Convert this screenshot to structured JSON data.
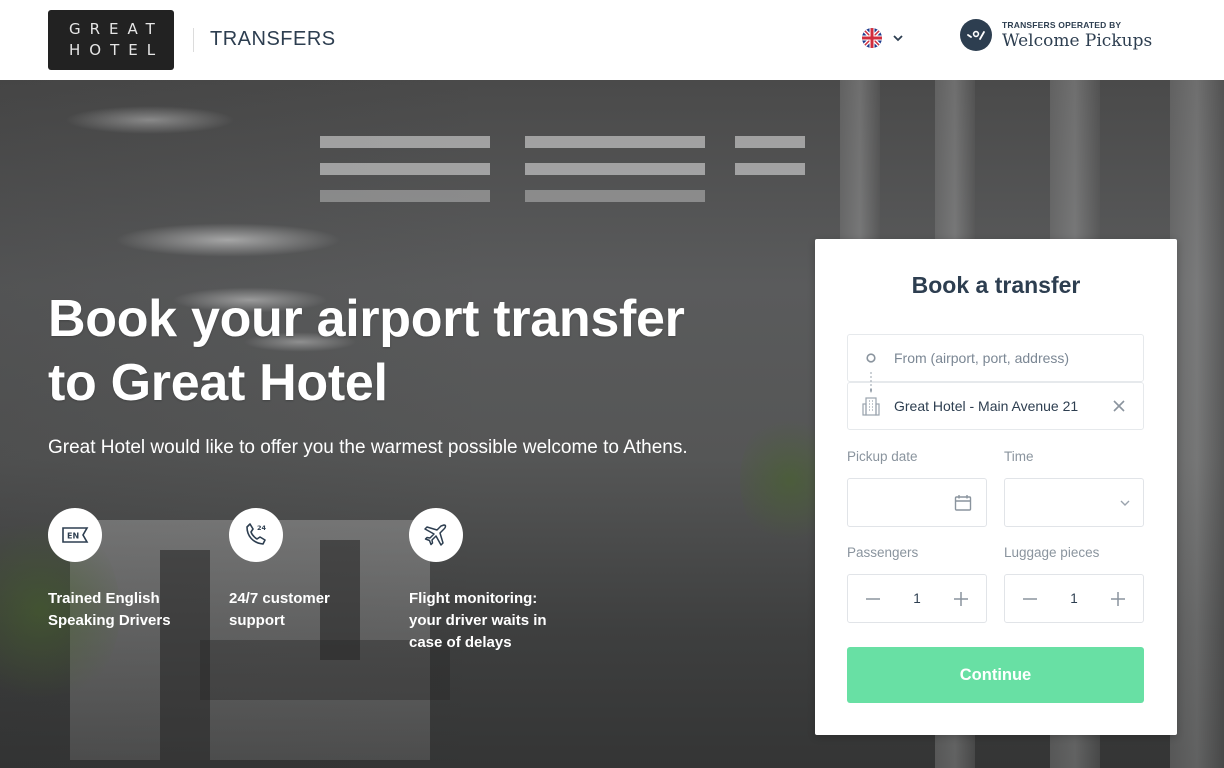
{
  "header": {
    "logo_line1": "GREAT",
    "logo_line2": "HOTEL",
    "section_title": "TRANSFERS",
    "language": {
      "icon": "uk-flag-icon",
      "selected": "English"
    },
    "operator_caption": "TRANSFERS OPERATED BY",
    "operator_name": "Welcome Pickups"
  },
  "hero": {
    "title_line1": "Book your airport transfer",
    "title_line2": "to Great Hotel",
    "subtitle": "Great Hotel would like to offer you the warmest possible welcome to Athens.",
    "features": [
      {
        "icon": "english-speaking-icon",
        "icon_text": "EN",
        "line1": "Trained English",
        "line2": "Speaking Drivers",
        "line3": ""
      },
      {
        "icon": "phone-24-icon",
        "icon_text": "24",
        "line1": "24/7 customer",
        "line2": "support",
        "line3": ""
      },
      {
        "icon": "airplane-icon",
        "icon_text": "",
        "line1": "Flight monitoring:",
        "line2": "your driver waits in",
        "line3": "case of delays"
      }
    ]
  },
  "booking": {
    "title": "Book a transfer",
    "from_placeholder": "From (airport, port, address)",
    "from_value": "",
    "to_value": "Great Hotel - Main Avenue 21",
    "pickup_date_label": "Pickup date",
    "pickup_date_value": "",
    "time_label": "Time",
    "time_value": "",
    "passengers_label": "Passengers",
    "passengers_value": "1",
    "luggage_label": "Luggage pieces",
    "luggage_value": "1",
    "continue_label": "Continue"
  },
  "colors": {
    "brand_dark": "#2d3e50",
    "continue_green": "#68e0a4",
    "label_gray": "#8a949e"
  }
}
